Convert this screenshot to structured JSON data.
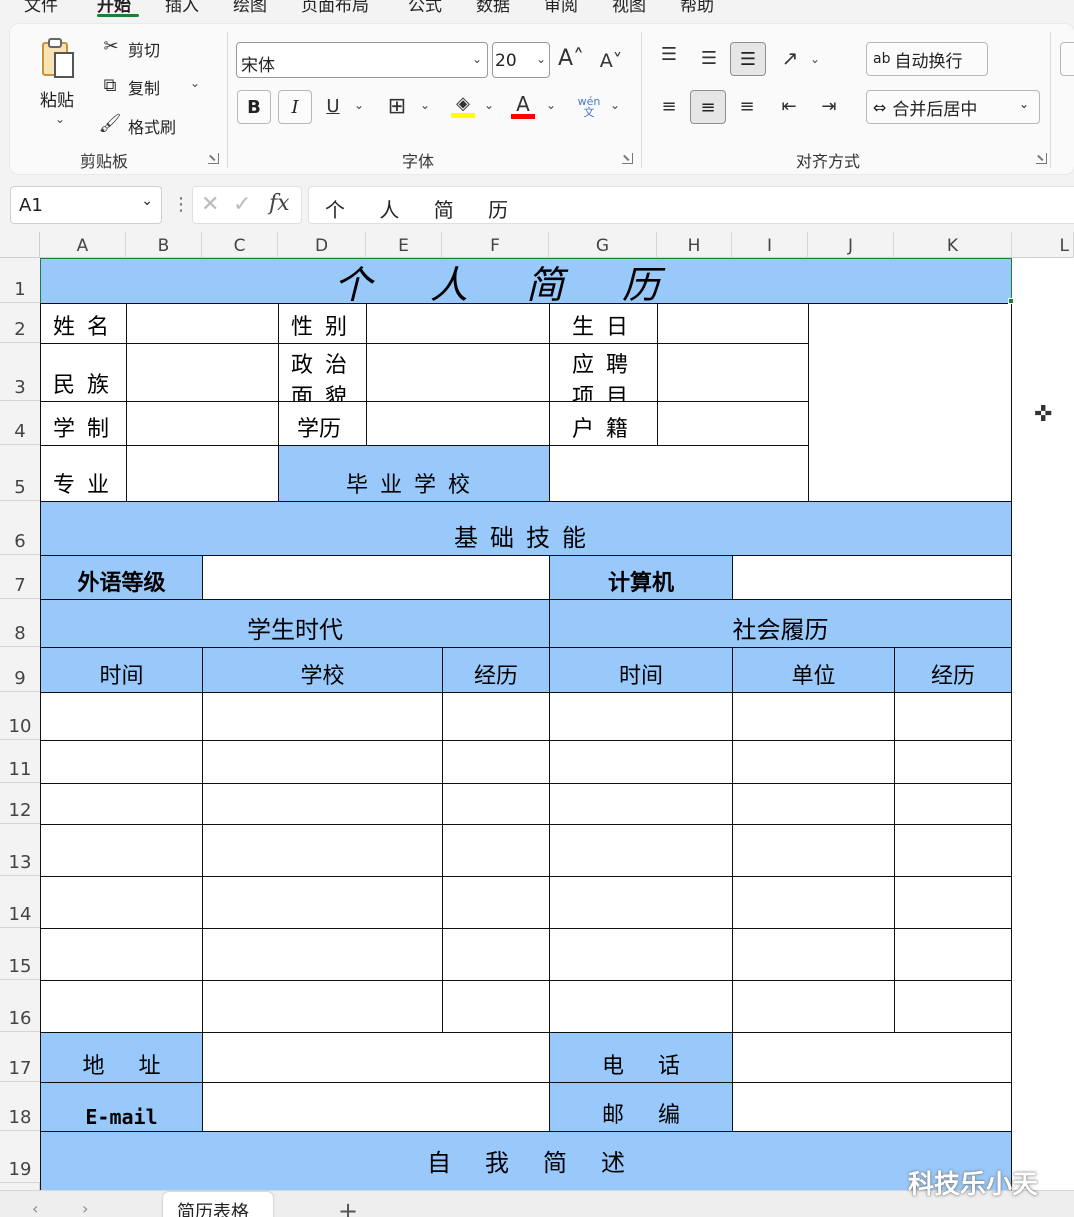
{
  "menu": {
    "items": [
      "文件",
      "开始",
      "插入",
      "绘图",
      "页面布局",
      "公式",
      "数据",
      "审阅",
      "视图",
      "帮助"
    ],
    "active": "开始"
  },
  "ribbon": {
    "clipboard": {
      "group_label": "剪贴板",
      "paste": "粘贴",
      "cut": "剪切",
      "copy": "复制",
      "format_painter": "格式刷"
    },
    "font": {
      "group_label": "字体",
      "font_name": "宋体",
      "font_size": "20",
      "bold": "B",
      "italic": "I",
      "underline": "U",
      "phonetic": "wén\n文",
      "font_color": "#ff0000",
      "highlight_color": "#ffff00"
    },
    "alignment": {
      "group_label": "对齐方式",
      "wrap_text": "自动换行",
      "merge_center": "合并后居中"
    }
  },
  "formula_bar": {
    "name_box": "A1",
    "formula": "个 人 简 历",
    "fx": "fx"
  },
  "columns": [
    "A",
    "B",
    "C",
    "D",
    "E",
    "F",
    "G",
    "H",
    "I",
    "J",
    "K",
    "L"
  ],
  "rows": [
    "1",
    "2",
    "3",
    "4",
    "5",
    "6",
    "7",
    "8",
    "9",
    "10",
    "11",
    "12",
    "13",
    "14",
    "15",
    "16",
    "17",
    "18",
    "19"
  ],
  "resume": {
    "title": "个人简历",
    "name": "姓名",
    "gender": "性别",
    "birthday": "生日",
    "ethnicity": "民族",
    "political_1": "政治",
    "political_2": "面貌",
    "position_1": "应聘",
    "position_2": "项目",
    "schooling": "学制",
    "education": "学历",
    "hukou": "户籍",
    "major": "专业",
    "graduate_school": "毕业学校",
    "skills": "基础技能",
    "language_level": "外语等级",
    "computer": "计算机",
    "student_era": "学生时代",
    "social_history": "社会履历",
    "time": "时间",
    "school": "学校",
    "experience": "经历",
    "employer": "单位",
    "address": "地址",
    "phone": "电话",
    "email": "E-mail",
    "postcode": "邮编",
    "self_intro": "自我简述"
  },
  "sheet_tab": "简历表格",
  "watermark": "科技乐小天",
  "colors": {
    "header_fill": "#99c9fb",
    "accent": "#1a7f37"
  }
}
